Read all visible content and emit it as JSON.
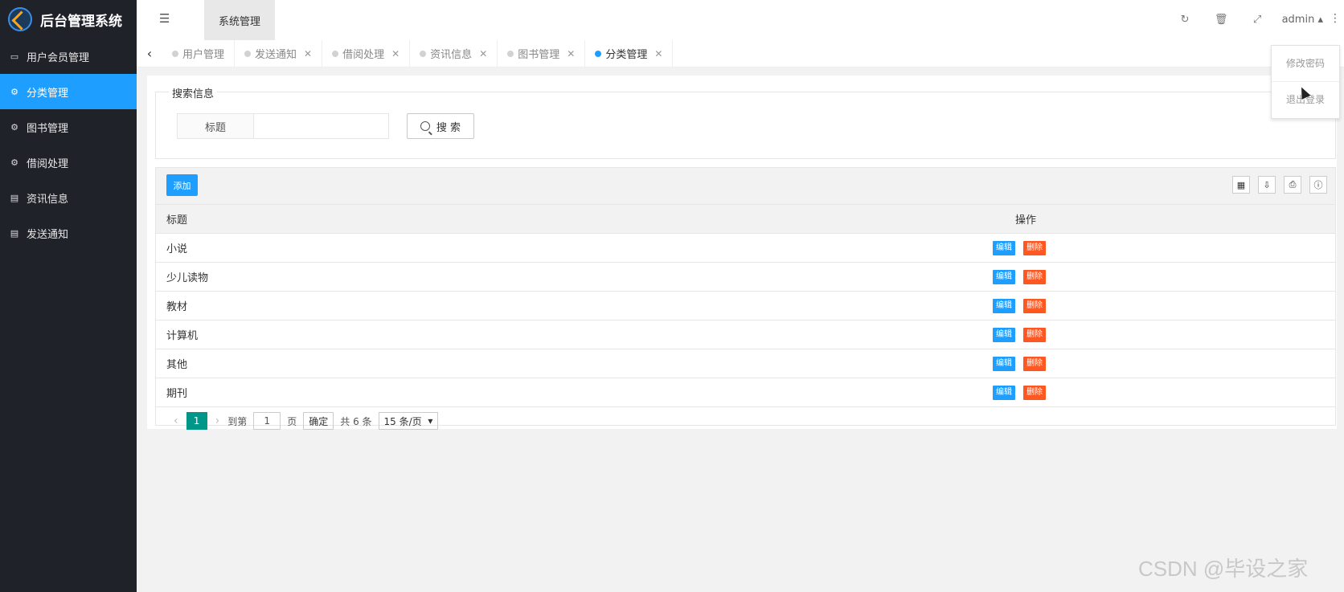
{
  "app": {
    "title": "后台管理系统"
  },
  "sidebar": {
    "items": [
      {
        "label": "用户会员管理",
        "icon": "window-icon",
        "active": false
      },
      {
        "label": "分类管理",
        "icon": "gears-icon",
        "active": true
      },
      {
        "label": "图书管理",
        "icon": "gears-icon",
        "active": false
      },
      {
        "label": "借阅处理",
        "icon": "gears-icon",
        "active": false
      },
      {
        "label": "资讯信息",
        "icon": "document-icon",
        "active": false
      },
      {
        "label": "发送通知",
        "icon": "document-icon",
        "active": false
      }
    ]
  },
  "header": {
    "tab_label": "系统管理",
    "user": "admin"
  },
  "tabs": [
    {
      "label": "用户管理",
      "closable": false,
      "active": false
    },
    {
      "label": "发送通知",
      "closable": true,
      "active": false
    },
    {
      "label": "借阅处理",
      "closable": true,
      "active": false
    },
    {
      "label": "资讯信息",
      "closable": true,
      "active": false
    },
    {
      "label": "图书管理",
      "closable": true,
      "active": false
    },
    {
      "label": "分类管理",
      "closable": true,
      "active": true
    }
  ],
  "user_menu": {
    "change_password": "修改密码",
    "logout": "退出登录"
  },
  "search": {
    "legend": "搜索信息",
    "field_label": "标题",
    "field_value": "",
    "button_label": "搜 索"
  },
  "table": {
    "add_label": "添加",
    "columns": [
      "标题",
      "操作"
    ],
    "rows": [
      {
        "title": "小说"
      },
      {
        "title": "少儿读物"
      },
      {
        "title": "教材"
      },
      {
        "title": "计算机"
      },
      {
        "title": "其他"
      },
      {
        "title": "期刊"
      }
    ],
    "edit_label": "编辑",
    "delete_label": "删除"
  },
  "pagination": {
    "current_page": "1",
    "goto_label": "到第",
    "goto_value": "1",
    "page_suffix": "页",
    "confirm_label": "确定",
    "total": "共 6 条",
    "page_size": "15 条/页"
  },
  "watermark": "CSDN @毕设之家",
  "colors": {
    "sidebar_bg": "#20222a",
    "accent": "#1e9fff",
    "danger": "#ff5722",
    "pager_active": "#009688"
  }
}
